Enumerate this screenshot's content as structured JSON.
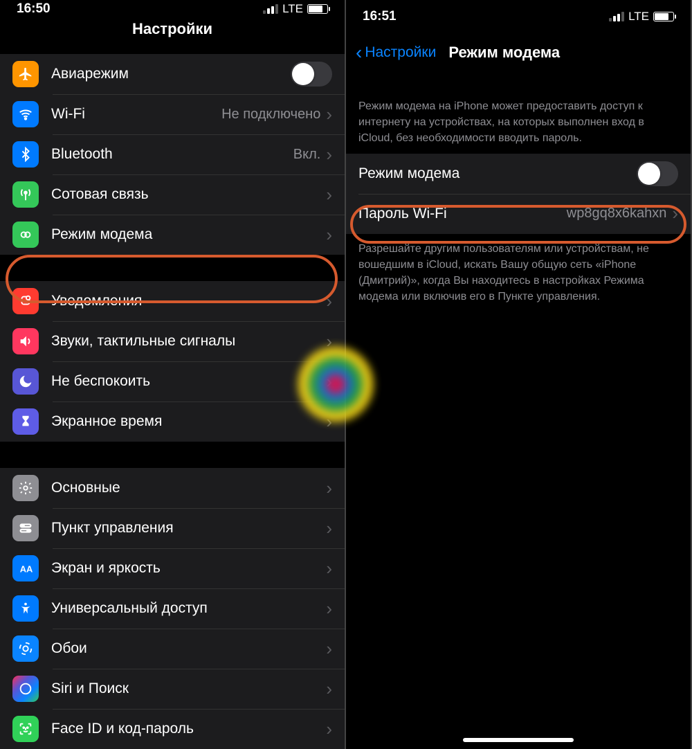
{
  "left": {
    "status": {
      "time": "16:50",
      "network": "LTE"
    },
    "title": "Настройки",
    "groups": [
      [
        {
          "icon": "airplane",
          "bg": "bg-orange",
          "label": "Авиарежим",
          "toggle": false
        },
        {
          "icon": "wifi",
          "bg": "bg-blue",
          "label": "Wi-Fi",
          "value": "Не подключено",
          "chev": true
        },
        {
          "icon": "bluetooth",
          "bg": "bg-blue",
          "label": "Bluetooth",
          "value": "Вкл.",
          "chev": true
        },
        {
          "icon": "antenna",
          "bg": "bg-green",
          "label": "Сотовая связь",
          "chev": true
        },
        {
          "icon": "hotspot",
          "bg": "bg-green",
          "label": "Режим модема",
          "chev": true
        }
      ],
      [
        {
          "icon": "bell",
          "bg": "bg-red",
          "label": "Уведомления",
          "chev": true
        },
        {
          "icon": "speaker",
          "bg": "bg-red2",
          "label": "Звуки, тактильные сигналы",
          "chev": true
        },
        {
          "icon": "moon",
          "bg": "bg-purple",
          "label": "Не беспокоить",
          "chev": true
        },
        {
          "icon": "hourglass",
          "bg": "bg-indigo",
          "label": "Экранное время",
          "chev": true
        }
      ],
      [
        {
          "icon": "gear",
          "bg": "bg-gray",
          "label": "Основные",
          "chev": true
        },
        {
          "icon": "switches",
          "bg": "bg-gray",
          "label": "Пункт управления",
          "chev": true
        },
        {
          "icon": "textsize",
          "bg": "bg-blue",
          "label": "Экран и яркость",
          "chev": true
        },
        {
          "icon": "accessibility",
          "bg": "bg-blue",
          "label": "Универсальный доступ",
          "chev": true
        },
        {
          "icon": "wallpaper",
          "bg": "bg-blue2",
          "label": "Обои",
          "chev": true
        },
        {
          "icon": "siri",
          "bg": "bg-multicolor",
          "label": "Siri и Поиск",
          "chev": true
        },
        {
          "icon": "faceid",
          "bg": "bg-green2",
          "label": "Face ID и код-пароль",
          "chev": true
        }
      ]
    ]
  },
  "right": {
    "status": {
      "time": "16:51",
      "network": "LTE"
    },
    "back": "Настройки",
    "title": "Режим модема",
    "intro": "Режим модема на iPhone может предоставить доступ к интернету на устройствах, на которых выполнен вход в iCloud, без необходимости вводить пароль.",
    "rows": {
      "hotspot_label": "Режим модема",
      "hotspot_on": false,
      "password_label": "Пароль Wi-Fi",
      "password_value": "wp8gq8x6kahxn"
    },
    "footer": "Разрешайте другим пользователям или устройствам, не вошедшим в iCloud, искать Вашу общую сеть «iPhone (Дмитрий)», когда Вы находитесь в настройках Режима модема или включив его в Пункте управления."
  }
}
